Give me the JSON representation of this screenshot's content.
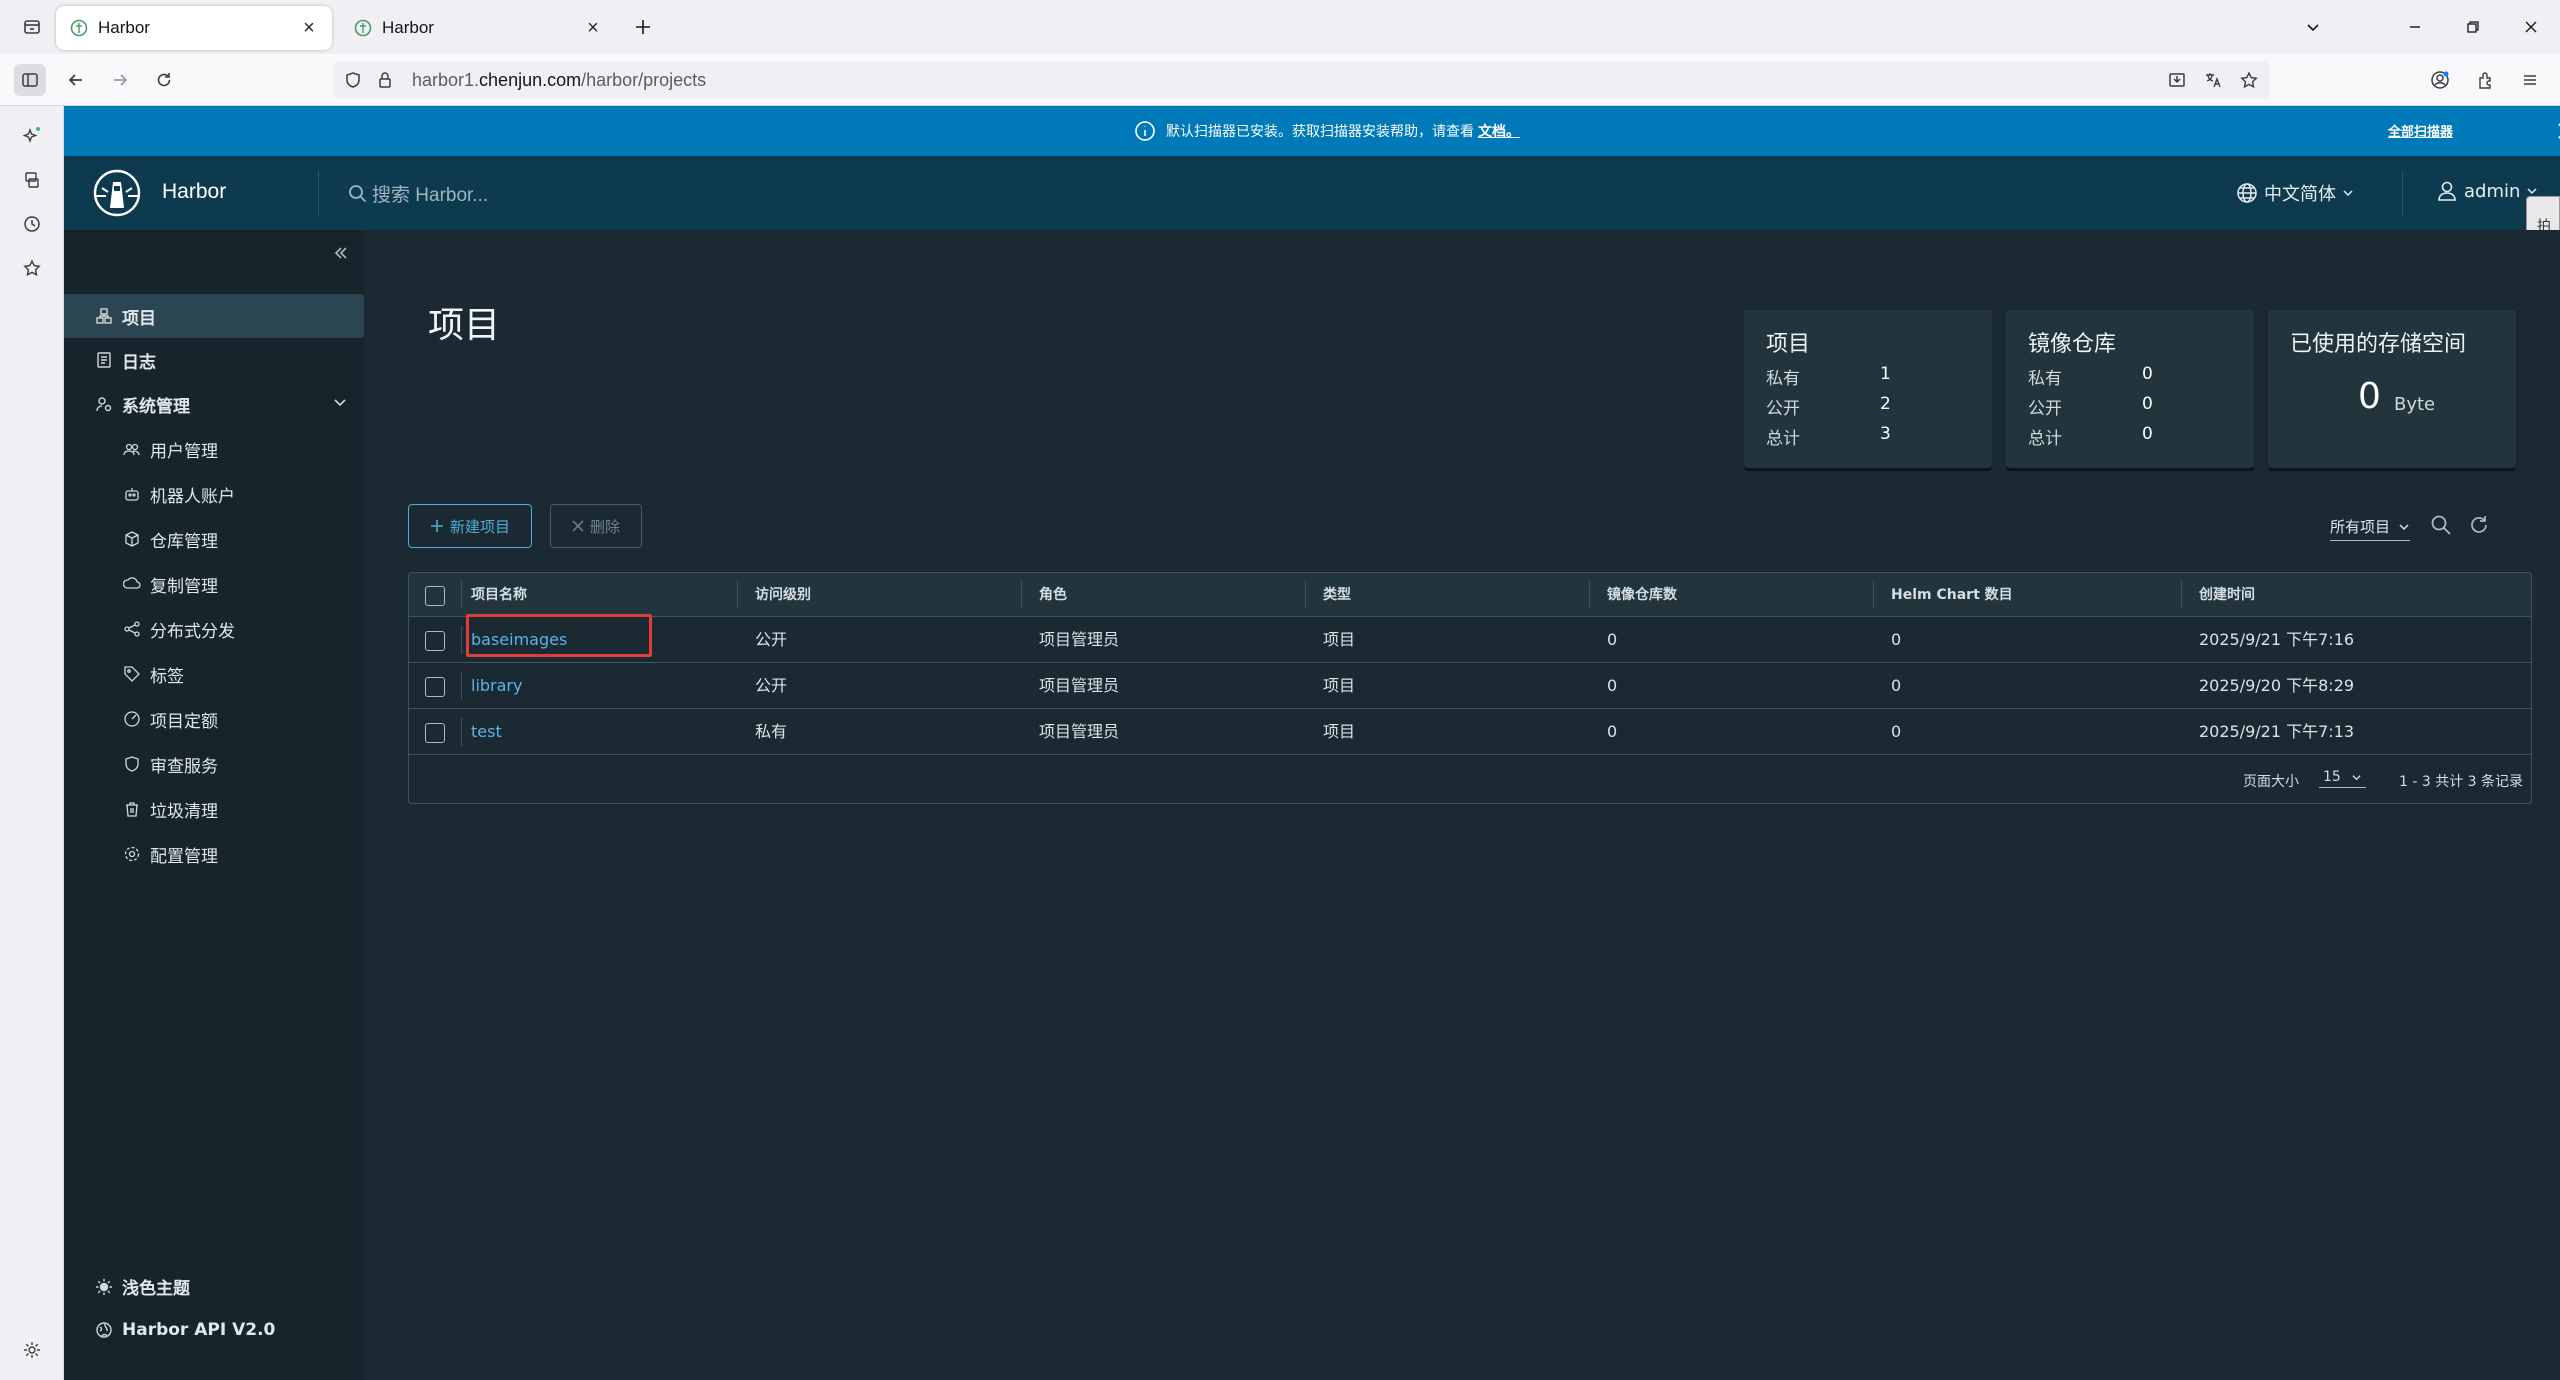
{
  "browser": {
    "tabs": [
      {
        "title": "Harbor",
        "active": true
      },
      {
        "title": "Harbor",
        "active": false
      }
    ],
    "url_prefix": "harbor1.",
    "url_domain": "chenjun.com",
    "url_path": "/harbor/projects"
  },
  "banner": {
    "message": "默认扫描器已安装。获取扫描器安装帮助，请查看",
    "link": "文档。",
    "close_all": "全部扫描器"
  },
  "header": {
    "app_name": "Harbor",
    "search_placeholder": "搜索 Harbor...",
    "language": "中文简体",
    "user": "admin",
    "side_tab": "拍日步骤"
  },
  "nav": {
    "items": [
      {
        "label": "项目",
        "icon": "projects-icon"
      },
      {
        "label": "日志",
        "icon": "logs-icon"
      },
      {
        "label": "系统管理",
        "icon": "admin-icon"
      }
    ],
    "sub_items": [
      {
        "label": "用户管理",
        "icon": "users-icon"
      },
      {
        "label": "机器人账户",
        "icon": "robot-icon"
      },
      {
        "label": "仓库管理",
        "icon": "registry-icon"
      },
      {
        "label": "复制管理",
        "icon": "replication-icon"
      },
      {
        "label": "分布式分发",
        "icon": "distribution-icon"
      },
      {
        "label": "标签",
        "icon": "tag-icon"
      },
      {
        "label": "项目定额",
        "icon": "quota-icon"
      },
      {
        "label": "审查服务",
        "icon": "shield-icon"
      },
      {
        "label": "垃圾清理",
        "icon": "trash-icon"
      },
      {
        "label": "配置管理",
        "icon": "gear-icon"
      }
    ],
    "theme": "浅色主题",
    "api": "Harbor API V2.0"
  },
  "main": {
    "title": "项目",
    "stats": {
      "projects": {
        "title": "项目",
        "private_label": "私有",
        "private": "1",
        "public_label": "公开",
        "public": "2",
        "total_label": "总计",
        "total": "3"
      },
      "repos": {
        "title": "镜像仓库",
        "private_label": "私有",
        "private": "0",
        "public_label": "公开",
        "public": "0",
        "total_label": "总计",
        "total": "0"
      },
      "storage": {
        "title": "已使用的存储空间",
        "value": "0",
        "unit": "Byte"
      }
    },
    "new_project": "新建项目",
    "delete": "删除",
    "filter": "所有项目",
    "columns": [
      "项目名称",
      "访问级别",
      "角色",
      "类型",
      "镜像仓库数",
      "Helm Chart 数目",
      "创建时间"
    ],
    "rows": [
      {
        "name": "baseimages",
        "access": "公开",
        "role": "项目管理员",
        "type": "项目",
        "repos": "0",
        "charts": "0",
        "created": "2025/9/21 下午7:16"
      },
      {
        "name": "library",
        "access": "公开",
        "role": "项目管理员",
        "type": "项目",
        "repos": "0",
        "charts": "0",
        "created": "2025/9/20 下午8:29"
      },
      {
        "name": "test",
        "access": "私有",
        "role": "项目管理员",
        "type": "项目",
        "repos": "0",
        "charts": "0",
        "created": "2025/9/21 下午7:13"
      }
    ],
    "page_size_label": "页面大小",
    "page_size": "15",
    "page_info": "1 - 3 共计 3 条记录"
  },
  "colors": {
    "accent": "#0079b8",
    "header_bg": "#0e3a4f",
    "link": "#57b5e7",
    "highlight": "#e03c3c"
  }
}
